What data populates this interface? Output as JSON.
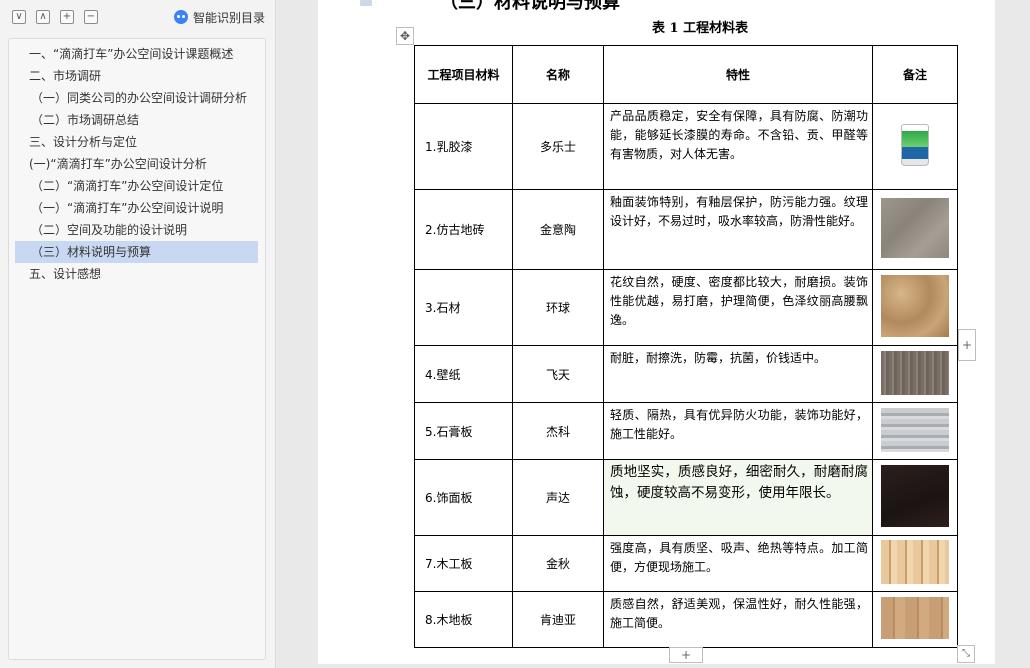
{
  "toolbar": {
    "expand_icon": "∨",
    "collapse_icon": "∧",
    "add_icon": "+",
    "remove_icon": "−",
    "smart_toc_label": "智能识别目录"
  },
  "outline": {
    "items": [
      {
        "label": "一、“滴滴打车”办公空间设计课题概述"
      },
      {
        "label": "二、市场调研"
      },
      {
        "label": "（一）同类公司的办公空间设计调研分析"
      },
      {
        "label": "（二）市场调研总结"
      },
      {
        "label": "三、设计分析与定位"
      },
      {
        "label": "(一)“滴滴打车”办公空间设计分析"
      },
      {
        "label": "（二）“滴滴打车”办公空间设计定位"
      },
      {
        "label": "（一）“滴滴打车”办公空间设计说明"
      },
      {
        "label": "（二）空间及功能的设计说明"
      },
      {
        "label": "（三）材料说明与预算"
      },
      {
        "label": "五、设计感想"
      }
    ],
    "active_index": 9
  },
  "document": {
    "section_title": "（三）材料说明与预算",
    "table_caption": "表 1 工程材料表",
    "move_icon": "✥",
    "add_col_icon": "+",
    "add_row_icon": "+",
    "resize_icon": "⤡"
  },
  "table": {
    "headers": [
      "工程项目材料",
      "名称",
      "特性",
      "备注"
    ],
    "rows": [
      {
        "material": "1.乳胶漆",
        "name": "多乐士",
        "feature": "产品品质稳定，安全有保障，具有防腐、防潮功能，能够延长漆膜的寿命。不含铅、贡、甲醛等有害物质，对人体无害。",
        "image": "paint-bucket-image"
      },
      {
        "material": "2.仿古地砖",
        "name": "金意陶",
        "feature": "釉面装饰特别，有釉层保护，防污能力强。纹理设计好，不易过时，吸水率较高，防滑性能好。",
        "image": "floor-tile-image"
      },
      {
        "material": "3.石材",
        "name": "环球",
        "feature": "花纹自然，硬度、密度都比较大，耐磨损。装饰性能优越，易打磨，护理简便，色泽纹丽高腰飘逸。",
        "image": "marble-image"
      },
      {
        "material": "4.壁纸",
        "name": "飞天",
        "feature": "耐脏，耐擦洗，防霉，抗菌，价钱适中。",
        "image": "wallpaper-image"
      },
      {
        "material": "5.石膏板",
        "name": "杰科",
        "feature": "轻质、隔热，具有优异防火功能，装饰功能好，施工性能好。",
        "image": "gypsum-board-image"
      },
      {
        "material": "6.饰面板",
        "name": "声达",
        "feature": "质地坚实，质感良好，细密耐久，耐磨耐腐蚀，硬度较高不易变形，使用年限长。",
        "image": "veneer-image"
      },
      {
        "material": "7.木工板",
        "name": "金秋",
        "feature": "强度高，具有质坚、吸声、绝热等特点。加工简便，方便现场施工。",
        "image": "plywood-image"
      },
      {
        "material": "8.木地板",
        "name": "肯迪亚",
        "feature": "质感自然，舒适美观，保温性好，耐久性能强，施工简便。",
        "image": "wood-floor-image"
      }
    ]
  }
}
